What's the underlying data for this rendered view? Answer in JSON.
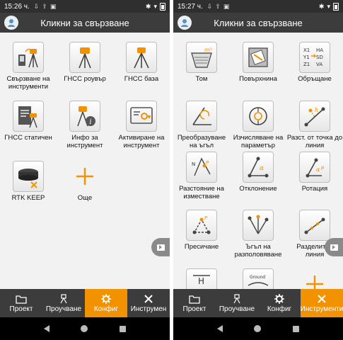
{
  "left": {
    "status": {
      "time": "15:26 ч."
    },
    "title": "Кликни за свързване",
    "tiles": [
      {
        "label": "Свързване на инструменти",
        "icon": "instrument-connect-icon"
      },
      {
        "label": "ГНСС роувър",
        "icon": "gnss-rover-icon"
      },
      {
        "label": "ГНСС база",
        "icon": "gnss-base-icon"
      },
      {
        "label": "ГНСС статичен",
        "icon": "gnss-static-icon"
      },
      {
        "label": "Инфо за инструмент",
        "icon": "instrument-info-icon"
      },
      {
        "label": "Активиране на инструмент",
        "icon": "activate-instrument-icon"
      },
      {
        "label": "RTK KEEP",
        "icon": "rtk-keep-icon"
      },
      {
        "label": "Още",
        "icon": "plus-icon"
      }
    ],
    "nav": [
      {
        "label": "Проект",
        "icon": "folder-icon"
      },
      {
        "label": "Проучване",
        "icon": "survey-icon"
      },
      {
        "label": "Конфиг",
        "icon": "gear-icon",
        "active": true
      },
      {
        "label": "Инструмен",
        "icon": "tools-icon"
      }
    ]
  },
  "right": {
    "status": {
      "time": "15:27 ч."
    },
    "title": "Кликни за свързване",
    "tiles": [
      {
        "label": "Том",
        "icon": "volume-icon"
      },
      {
        "label": "Повърхнина",
        "icon": "area-icon"
      },
      {
        "label": "Обръщане",
        "icon": "coordinate-transform-icon"
      },
      {
        "label": "Преобразуване на ъгъл",
        "icon": "angle-convert-icon"
      },
      {
        "label": "Изчисляване на параметър",
        "icon": "parameter-calc-icon"
      },
      {
        "label": "Разст. от точка до линия",
        "icon": "point-line-distance-icon"
      },
      {
        "label": "Разстояние на изместване",
        "icon": "offset-distance-icon"
      },
      {
        "label": "Отклонение",
        "icon": "deviation-icon"
      },
      {
        "label": "Ротация",
        "icon": "rotation-icon"
      },
      {
        "label": "Пресичане",
        "icon": "intersection-icon"
      },
      {
        "label": "Ъгъл на разполовяване",
        "icon": "bisect-angle-icon"
      },
      {
        "label": "Разделител линия",
        "icon": "divide-line-icon"
      },
      {
        "label": "",
        "icon": "height-icon"
      },
      {
        "label": "",
        "icon": "ground-icon"
      },
      {
        "label": "",
        "icon": "plus-icon"
      }
    ],
    "nav": [
      {
        "label": "Проект",
        "icon": "folder-icon"
      },
      {
        "label": "Проучване",
        "icon": "survey-icon"
      },
      {
        "label": "Конфиг",
        "icon": "gear-icon"
      },
      {
        "label": "Инструменти",
        "icon": "tools-icon",
        "active": true
      }
    ]
  },
  "colors": {
    "accent": "#f39200",
    "bar": "#3c3c3c",
    "background": "#f2f2f2"
  }
}
